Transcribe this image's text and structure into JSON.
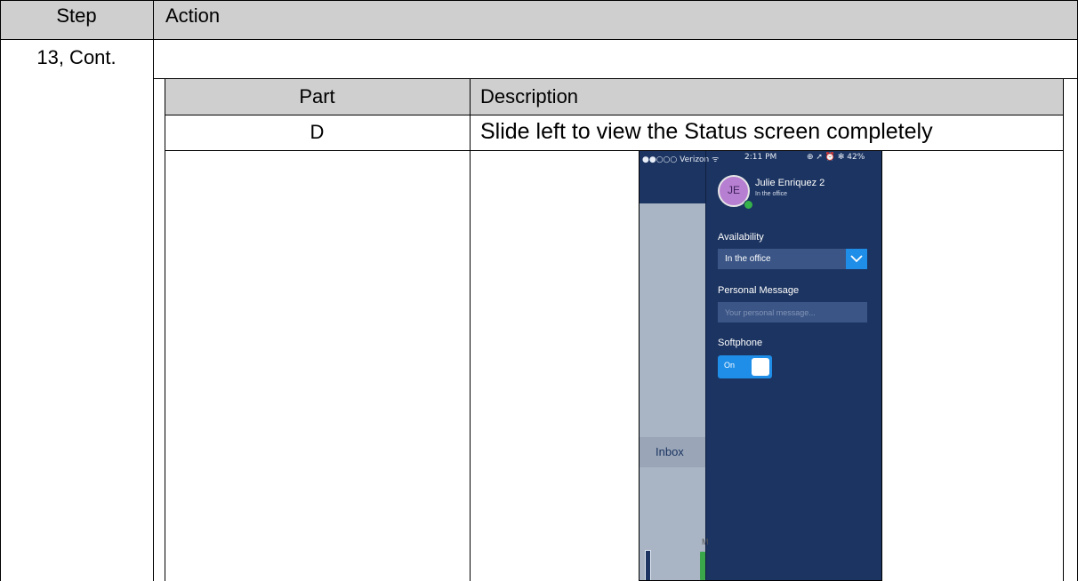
{
  "outer_table": {
    "headers": {
      "step": "Step",
      "action": "Action"
    },
    "row": {
      "step": "13, Cont."
    }
  },
  "inner_table": {
    "headers": {
      "part": "Part",
      "description": "Description"
    },
    "row": {
      "part": "D",
      "description": "Slide left to view the Status screen completely"
    }
  },
  "phone": {
    "status_bar": {
      "carrier": "●●○○○ Verizon ᯤ",
      "time": "2:11 PM",
      "indicators": "⊕ ➚ ⏰ ✻ 42%"
    },
    "user": {
      "initials": "JE",
      "name": "Julie Enriquez 2",
      "status": "In the office"
    },
    "availability": {
      "label": "Availability",
      "value": "In the office"
    },
    "personal_message": {
      "label": "Personal Message",
      "placeholder": "Your personal message..."
    },
    "softphone": {
      "label": "Softphone",
      "toggle_label": "On",
      "on": true
    },
    "background_panel": {
      "inbox_label": "Inbox",
      "partial_letter": "M"
    },
    "colors": {
      "panel": "#1c3461",
      "accent": "#1f8ee8",
      "presence": "#35b24a",
      "avatar": "#b77fd1"
    }
  }
}
